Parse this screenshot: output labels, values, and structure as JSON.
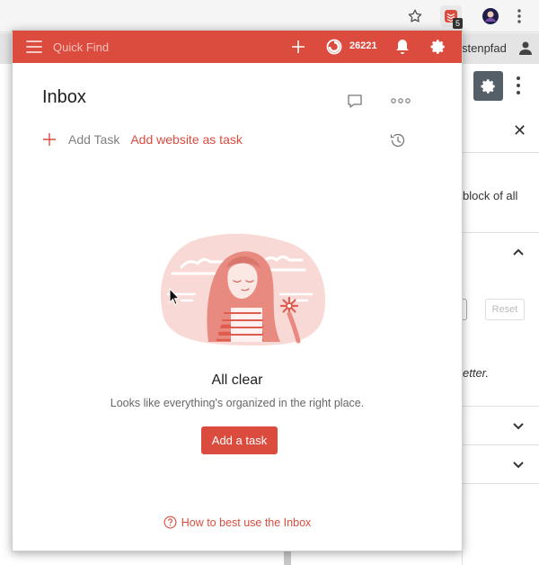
{
  "browser": {
    "extension_badge": "5",
    "icons": [
      "star-icon",
      "todoist-extension-icon",
      "user-extension-icon",
      "kebab-menu-icon"
    ]
  },
  "background_page": {
    "breadcrumb_fragment": "stenpfad",
    "panel_text_1": "block of all",
    "panel_text_2": "etter.",
    "reset_label": "Reset"
  },
  "popup": {
    "header": {
      "quick_find": "Quick Find",
      "karma": "26221",
      "color": "#db4c3f"
    },
    "title": "Inbox",
    "add_task_label": "Add Task",
    "add_website_label": "Add website as task",
    "empty_state": {
      "heading": "All clear",
      "message": "Looks like everything's organized in the right place.",
      "button_label": "Add a task"
    },
    "help_link": "How to best use the Inbox"
  }
}
